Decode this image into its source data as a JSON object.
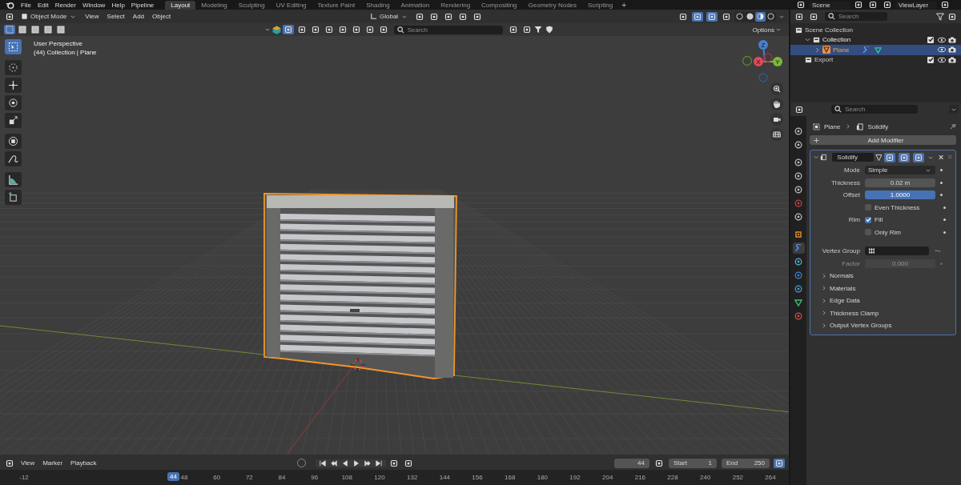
{
  "top_bar": {
    "menus": [
      "File",
      "Edit",
      "Render",
      "Window",
      "Help",
      "Pipeline"
    ],
    "workspaces": [
      {
        "label": "Layout",
        "selected": true
      },
      {
        "label": "Modeling",
        "selected": false
      },
      {
        "label": "Sculpting",
        "selected": false
      },
      {
        "label": "UV Editing",
        "selected": false
      },
      {
        "label": "Texture Paint",
        "selected": false
      },
      {
        "label": "Shading",
        "selected": false
      },
      {
        "label": "Animation",
        "selected": false
      },
      {
        "label": "Rendering",
        "selected": false
      },
      {
        "label": "Compositing",
        "selected": false
      },
      {
        "label": "Geometry Nodes",
        "selected": false
      },
      {
        "label": "Scripting",
        "selected": false
      }
    ],
    "add_workspace": "+",
    "scene": "Scene",
    "view_layer": "ViewLayer"
  },
  "viewport": {
    "mode": "Object Mode",
    "menus": [
      "View",
      "Select",
      "Add",
      "Object"
    ],
    "orientation": "Global",
    "search_placeholder": "Search",
    "options": "Options",
    "shading": [
      {
        "selected": false
      },
      {
        "selected": false
      },
      {
        "selected": true
      },
      {
        "selected": false
      }
    ],
    "overlay_text": [
      "User Perspective",
      "(44) Collection | Plane"
    ],
    "tools": [
      {
        "selected": true
      },
      {
        "selected": false
      },
      {
        "selected": false
      },
      {
        "selected": false
      },
      {
        "selected": false
      },
      {
        "selected": false
      },
      {
        "selected": false
      },
      {
        "selected": false
      },
      {
        "selected": false
      }
    ],
    "gizmo_axes": [
      "Z",
      "X",
      "Y"
    ]
  },
  "outliner": {
    "search_placeholder": "Search",
    "tree": [
      {
        "label": "Scene Collection",
        "selected": false,
        "children": [
          {
            "label": "Collection",
            "selected": false,
            "expanded": true,
            "checked": true,
            "children": [
              {
                "label": "Plane",
                "selected": true,
                "expanded": false
              }
            ]
          },
          {
            "label": "Export",
            "selected": false,
            "checked": true
          }
        ]
      }
    ]
  },
  "properties": {
    "search_placeholder": "Search",
    "breadcrumb": [
      "Plane",
      "Solidify"
    ],
    "add_modifier": "Add Modifier",
    "tabs": [
      {
        "selected": false
      },
      {
        "selected": false
      },
      {
        "selected": false
      },
      {
        "selected": false
      },
      {
        "selected": false
      },
      {
        "selected": false
      },
      {
        "selected": false
      },
      {
        "selected": false
      },
      {
        "selected": true
      },
      {
        "selected": false
      },
      {
        "selected": false
      },
      {
        "selected": false
      },
      {
        "selected": false
      },
      {
        "selected": false
      }
    ],
    "modifier": {
      "name": "Solidify",
      "expanded": true,
      "fields": [
        {
          "kind": "dropdown",
          "label": "Mode",
          "value": "Simple"
        },
        {
          "kind": "number",
          "label": "Thickness",
          "value": "0.02 m",
          "disabled": false
        },
        {
          "kind": "slider",
          "label": "Offset",
          "value": "1.0000",
          "level": 1
        },
        {
          "kind": "checkbox",
          "text": "Even Thickness",
          "checked": false
        },
        {
          "kind": "checkbox",
          "label": "Rim",
          "text": "Fill",
          "checked": true
        },
        {
          "kind": "checkbox",
          "text": "Only Rim",
          "checked": false
        },
        {
          "kind": "group",
          "label": "Vertex Group"
        },
        {
          "kind": "number",
          "label": "Factor",
          "value": "0.000",
          "disabled": true
        }
      ],
      "subpanels": [
        "Normals",
        "Materials",
        "Edge Data",
        "Thickness Clamp",
        "Output Vertex Groups"
      ]
    }
  },
  "timeline": {
    "menus": [
      "View",
      "Marker",
      "Playback"
    ],
    "current_frame": "44",
    "start_label": "Start",
    "start": "1",
    "end_label": "End",
    "end": "250",
    "playhead": "44",
    "ruler": [
      "-12",
      "48",
      "60",
      "72",
      "84",
      "96",
      "108",
      "120",
      "132",
      "144",
      "156",
      "168",
      "180",
      "192",
      "204",
      "216",
      "228",
      "240",
      "252",
      "264"
    ]
  }
}
